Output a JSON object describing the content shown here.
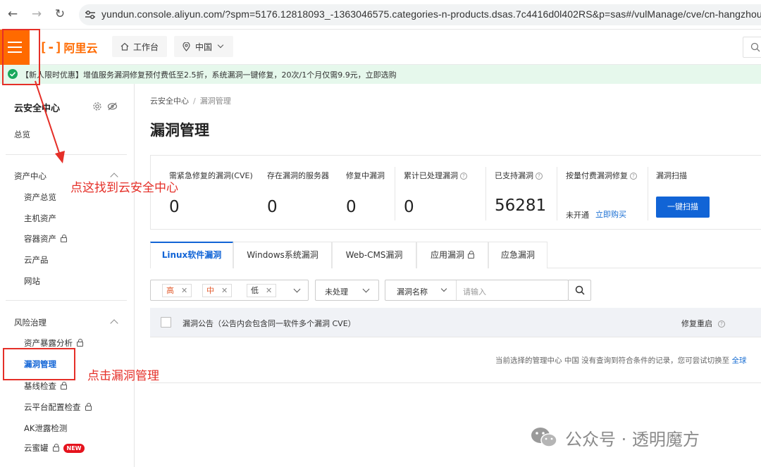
{
  "browser": {
    "url": "yundun.console.aliyun.com/?spm=5176.12818093_-1363046575.categories-n-products.dsas.7c4416d0l402RS&p=sas#/vulManage/cve/cn-hangzhou"
  },
  "header": {
    "logo_text": "阿里云",
    "workbench_label": "工作台",
    "region_label": "中国"
  },
  "banner": {
    "text": "【新人限时优惠】增值服务漏洞修复预付费低至2.5折，系统漏洞一键修复，20次/1个月仅需9.9元，立即选购"
  },
  "sidebar": {
    "title": "云安全中心",
    "overview": "总览",
    "groups": [
      {
        "label": "资产中心",
        "items": [
          "资产总览",
          "主机资产",
          "容器资产",
          "云产品",
          "网站"
        ]
      },
      {
        "label": "风险治理",
        "items": [
          "资产暴露分析",
          "漏洞管理",
          "基线检查",
          "云平台配置检查",
          "AK泄露检测",
          "云蜜罐"
        ]
      }
    ],
    "new_badge": "NEW"
  },
  "main": {
    "breadcrumb": {
      "root": "云安全中心",
      "current": "漏洞管理"
    },
    "title": "漏洞管理",
    "stats": [
      {
        "label": "需紧急修复的漏洞(CVE)",
        "value": "0"
      },
      {
        "label": "存在漏洞的服务器",
        "value": "0"
      },
      {
        "label": "修复中漏洞",
        "value": "0"
      },
      {
        "label": "累计已处理漏洞",
        "value": "0"
      },
      {
        "label": "已支持漏洞",
        "value": "56281"
      },
      {
        "label": "按量付费漏洞修复",
        "status": "未开通",
        "link": "立即购买"
      },
      {
        "label": "漏洞扫描",
        "button": "一键扫描"
      }
    ],
    "tabs": [
      "Linux软件漏洞",
      "Windows系统漏洞",
      "Web-CMS漏洞",
      "应用漏洞",
      "应急漏洞"
    ],
    "filters": {
      "levels": [
        "高",
        "中",
        "低"
      ],
      "status": "未处理",
      "field": "漏洞名称",
      "search_placeholder": "请输入"
    },
    "table": {
      "col_notice": "漏洞公告（公告内会包含同一软件多个漏洞 CVE）",
      "col_reboot": "修复重启"
    },
    "empty_note": "当前选择的管理中心 中国 没有查询到符合条件的记录，您可尝试切换至",
    "empty_link": "全球"
  },
  "annotations": {
    "find_center": "点这找到云安全中心",
    "click_vuln": "点击漏洞管理"
  },
  "watermark": "公众号 · 透明魔方"
}
